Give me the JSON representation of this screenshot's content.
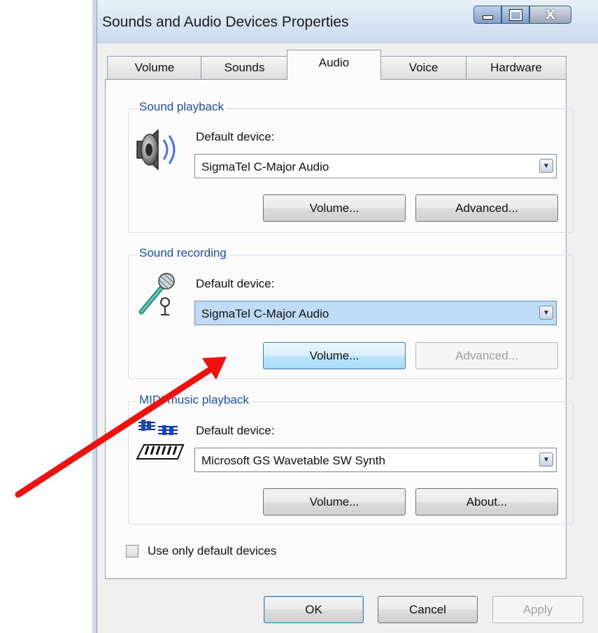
{
  "window": {
    "title": "Sounds and Audio Devices Properties"
  },
  "tabs": [
    {
      "label": "Volume"
    },
    {
      "label": "Sounds"
    },
    {
      "label": "Audio",
      "active": true
    },
    {
      "label": "Voice"
    },
    {
      "label": "Hardware"
    }
  ],
  "playback": {
    "group_title": "Sound playback",
    "default_label": "Default device:",
    "device": "SigmaTel C-Major Audio",
    "volume_button": "Volume...",
    "advanced_button": "Advanced..."
  },
  "recording": {
    "group_title": "Sound recording",
    "default_label": "Default device:",
    "device": "SigmaTel C-Major Audio",
    "volume_button": "Volume...",
    "advanced_button": "Advanced..."
  },
  "midi": {
    "group_title": "MIDI music playback",
    "default_label": "Default device:",
    "device": "Microsoft GS Wavetable SW Synth",
    "volume_button": "Volume...",
    "about_button": "About..."
  },
  "options": {
    "default_devices_label": "Use only default devices",
    "checked": false
  },
  "footer": {
    "ok": "OK",
    "cancel": "Cancel",
    "apply": "Apply"
  },
  "annotation": {
    "arrow_color": "#ee1111"
  },
  "icons": [
    "speaker-icon",
    "microphone-icon",
    "midi-keyboard-icon",
    "dropdown-arrow-icon"
  ]
}
